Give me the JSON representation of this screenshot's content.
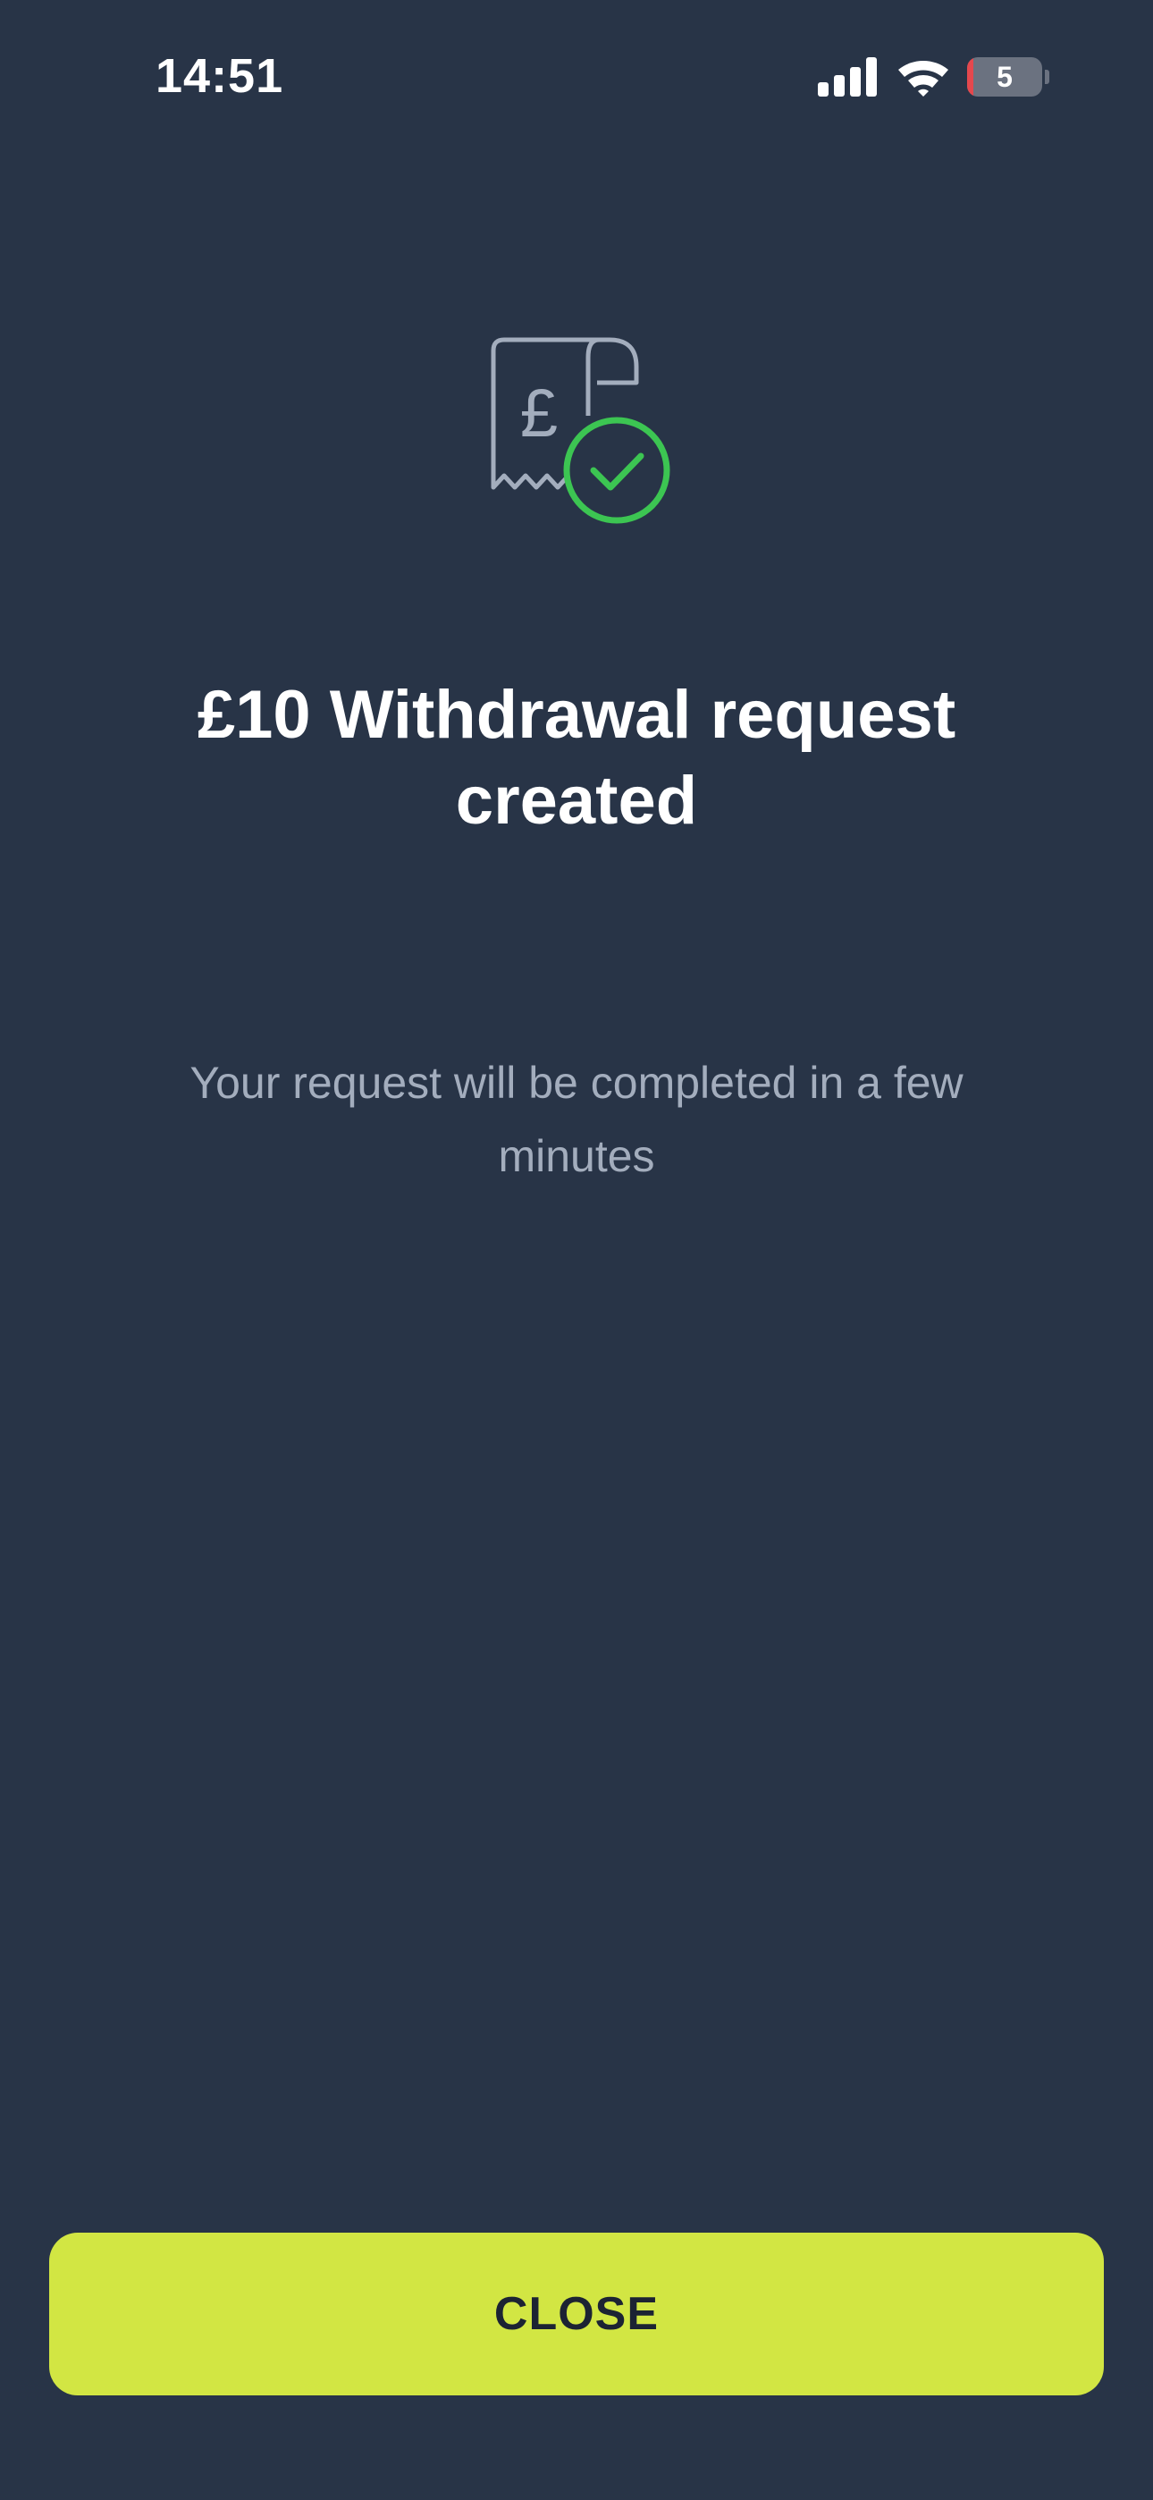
{
  "status_bar": {
    "time": "14:51",
    "battery_level": "5",
    "icons": [
      "cellular-signal-icon",
      "wifi-icon",
      "battery-icon"
    ]
  },
  "main": {
    "icon": "receipt-pound-check-icon",
    "icon_currency": "£",
    "title": "£10 Withdrawal request created",
    "subtitle": "Your request will be completed in a few minutes"
  },
  "footer": {
    "close_label": "CLOSE"
  },
  "colors": {
    "background": "#283447",
    "accent": "#d2e643",
    "success": "#3cc552",
    "icon_stroke": "#a3adbd"
  }
}
